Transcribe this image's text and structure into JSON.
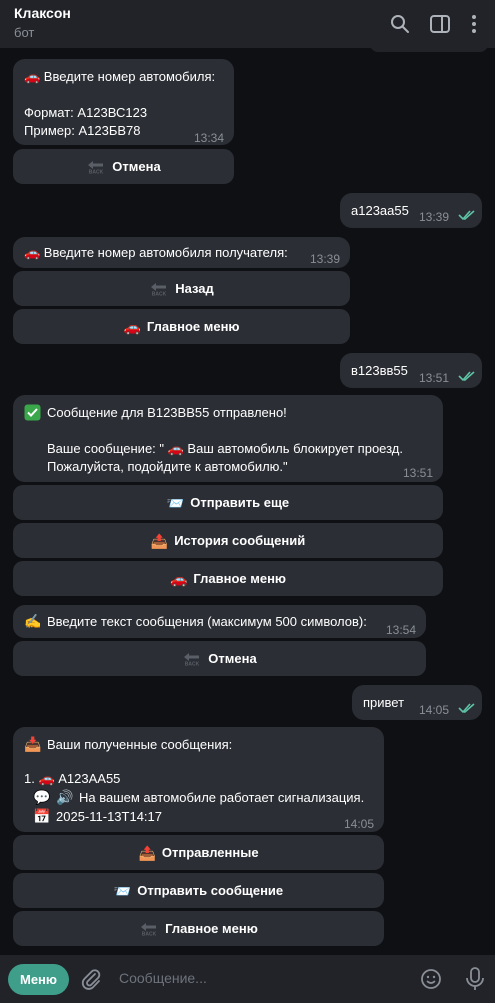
{
  "header": {
    "title": "Клаксон",
    "subtitle": "бот"
  },
  "icons": {
    "search": "search-icon",
    "sidebar": "sidebar-toggle-icon",
    "more": "more-vertical-icon",
    "attach": "paperclip-icon",
    "emoji": "emoji-icon",
    "mic": "microphone-icon"
  },
  "messages": {
    "m1": {
      "text": "🚗 Введите номер автомобиля:\n\nФормат: А123ВС123\nПример: А123БВ78",
      "time": "13:34"
    },
    "m1_cancel": "Отмена",
    "o1": {
      "text": "а123аа55",
      "time": "13:39"
    },
    "m2": {
      "text": "🚗 Введите номер автомобиля получателя:",
      "time": "13:39"
    },
    "m2_back": "Назад",
    "m2_main": "Главное меню",
    "o2": {
      "text": "в123вв55",
      "time": "13:51"
    },
    "m3": {
      "text": "Сообщение для В123ВВ55 отправлено!\n\nВаше сообщение: \" 🚗 Ваш автомобиль блокирует проезд.\nПожалуйста, подойдите к автомобилю.\"",
      "time": "13:51"
    },
    "m3_send_more": "Отправить еще",
    "m3_history": "История сообщений",
    "m3_main": "Главное меню",
    "m4": {
      "text": "Введите текст сообщения (максимум 500 символов):",
      "time": "13:54"
    },
    "m4_cancel": "Отмена",
    "o3": {
      "text": "привет",
      "time": "14:05"
    },
    "m5": {
      "title": "Ваши полученные сообщения:",
      "line1": "1. 🚗 А123АА55",
      "line2": "На вашем автомобиле работает сигнализация.",
      "line3": "2025-11-13T14:17",
      "time": "14:05"
    },
    "m5_sent": "Отправленные",
    "m5_send_msg": "Отправить сообщение",
    "m5_main": "Главное меню"
  },
  "bottom_bar": {
    "menu_label": "Меню",
    "placeholder": "Сообщение..."
  },
  "colors": {
    "background": "#0e1014",
    "bubble": "#2b2e34",
    "header": "#212329",
    "accent": "#3f9e8a",
    "read_ticks": "#5fc3a8",
    "muted_text": "#8a8e96"
  }
}
